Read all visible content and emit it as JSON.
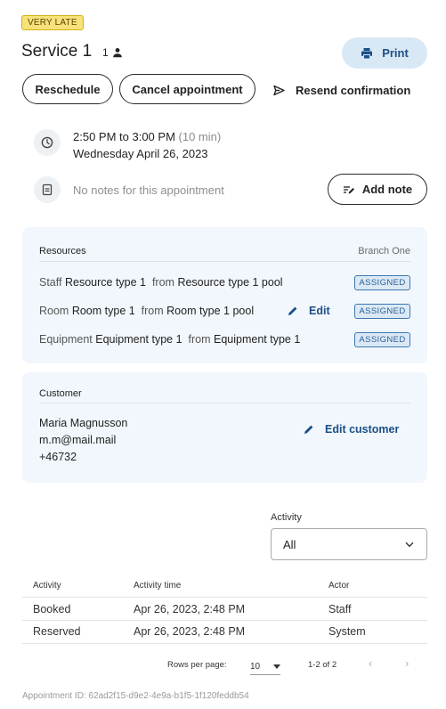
{
  "status_badge": "VERY LATE",
  "service": {
    "title": "Service 1",
    "count": "1"
  },
  "actions": {
    "print": "Print",
    "reschedule": "Reschedule",
    "cancel": "Cancel appointment",
    "resend": "Resend confirmation"
  },
  "time": {
    "range": "2:50 PM to 3:00 PM",
    "duration": "(10 min)",
    "date": "Wednesday April 26, 2023"
  },
  "notes": {
    "empty_text": "No notes for this appointment",
    "add_label": "Add note"
  },
  "resources": {
    "heading": "Resources",
    "branch": "Branch One",
    "items": [
      {
        "kind": "Staff",
        "type": "Resource type 1",
        "from": "from",
        "pool": "Resource type 1 pool",
        "status": "ASSIGNED"
      },
      {
        "kind": "Room",
        "type": "Room type 1",
        "from": "from",
        "pool": "Room type 1 pool",
        "status": "ASSIGNED",
        "edit": "Edit"
      },
      {
        "kind": "Equipment",
        "type": "Equipment type 1",
        "from": "from",
        "pool": "Equipment type 1",
        "status": "ASSIGNED"
      }
    ]
  },
  "customer": {
    "heading": "Customer",
    "name": "Maria Magnusson",
    "email": "m.m@mail.mail",
    "phone": "+46732",
    "edit_label": "Edit customer"
  },
  "activity_filter": {
    "label": "Activity",
    "value": "All"
  },
  "activity_table": {
    "columns": [
      "Activity",
      "Activity time",
      "Actor"
    ],
    "rows": [
      [
        "Booked",
        "Apr 26, 2023, 2:48 PM",
        "Staff"
      ],
      [
        "Reserved",
        "Apr 26, 2023, 2:48 PM",
        "System"
      ]
    ]
  },
  "pagination": {
    "rows_per_page_label": "Rows per page:",
    "rows_per_page": "10",
    "range": "1-2 of 2"
  },
  "appointment_id": "Appointment ID: 62ad2f15-d9e2-4e9a-b1f5-1f120feddb54",
  "icons": {
    "person": "person-icon",
    "print": "print-icon",
    "send": "send-icon",
    "clock": "clock-icon",
    "note": "note-icon",
    "add_note": "add-note-icon",
    "edit": "pencil-icon",
    "dropdown": "chevron-down-icon",
    "prev": "chevron-left-icon",
    "next": "chevron-right-icon"
  },
  "colors": {
    "accent": "#1c4f86",
    "badge_late": "#f7e17a",
    "panel_bg": "#f1f7fc",
    "print_bg": "#d9e8f5"
  }
}
